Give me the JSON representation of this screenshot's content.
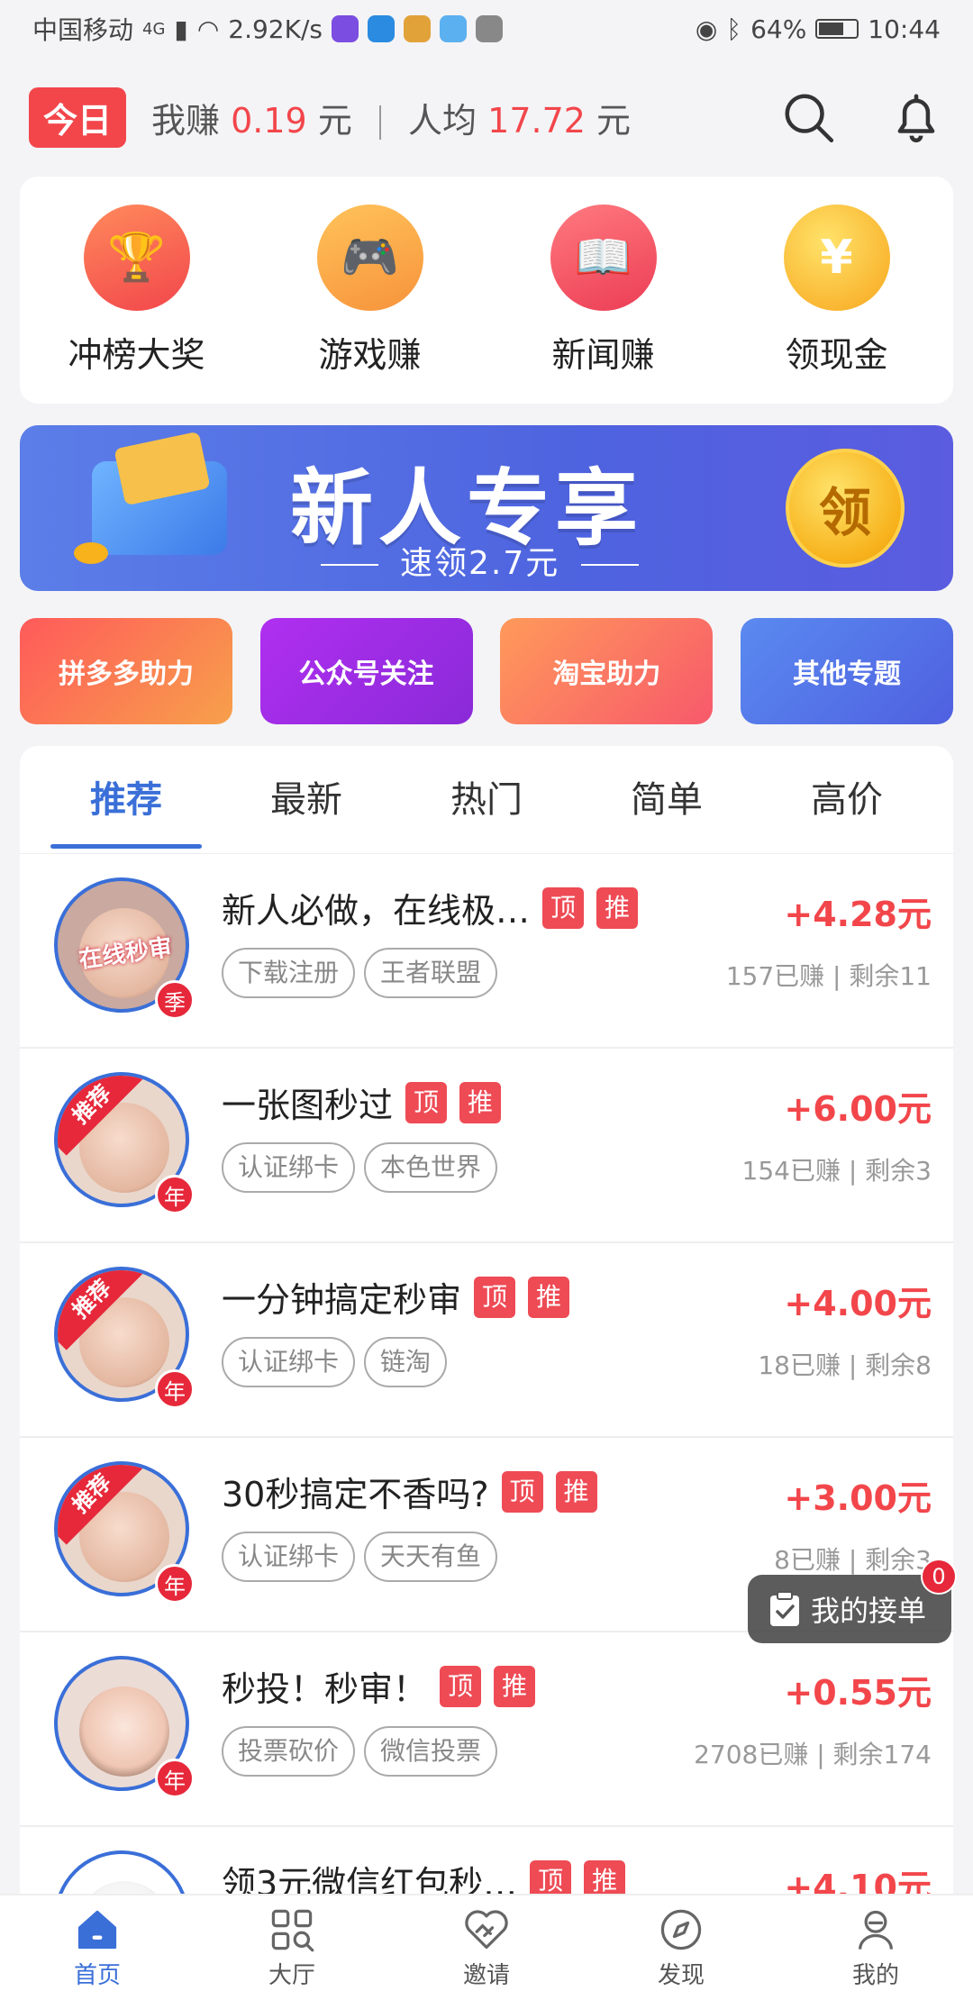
{
  "status_bar": {
    "carrier": "中国移动",
    "network": "4G",
    "speed": "2.92K/s",
    "battery": "64%",
    "time": "10:44"
  },
  "header": {
    "today_badge": "今日",
    "my_earn_label": "我赚",
    "my_earn_value": "0.19",
    "unit": "元",
    "avg_label": "人均",
    "avg_value": "17.72"
  },
  "quick_nav": [
    {
      "label": "冲榜大奖",
      "icon": "trophy-icon",
      "color": "#f2464b"
    },
    {
      "label": "游戏赚",
      "icon": "gamepad-icon",
      "color": "#f7a33b"
    },
    {
      "label": "新闻赚",
      "icon": "news-icon",
      "color": "#f0515d"
    },
    {
      "label": "领现金",
      "icon": "yuan-coin-icon",
      "color": "#f7b21c"
    }
  ],
  "banner": {
    "title": "新人专享",
    "subtitle": "速领2.7元",
    "coin_label": "领"
  },
  "topics": [
    {
      "label": "拼多多助力",
      "color": "#f7624b"
    },
    {
      "label": "公众号关注",
      "color": "#9b2de0"
    },
    {
      "label": "淘宝助力",
      "color": "#f76d6d"
    },
    {
      "label": "其他专题",
      "color": "#4f72e8"
    }
  ],
  "tabs": [
    "推荐",
    "最新",
    "热门",
    "简单",
    "高价"
  ],
  "tasks": [
    {
      "title": "新人必做，在线极…",
      "tag1": "顶",
      "tag2": "推",
      "chips": [
        "下载注册",
        "王者联盟"
      ],
      "reward": "+4.28元",
      "stats": "157已赚 | 剩余11",
      "badge": "季",
      "avatar_text": "在线秒审"
    },
    {
      "title": "一张图秒过",
      "tag1": "顶",
      "tag2": "推",
      "chips": [
        "认证绑卡",
        "本色世界"
      ],
      "reward": "+6.00元",
      "stats": "154已赚 | 剩余3",
      "badge": "年",
      "avatar_text": "推荐"
    },
    {
      "title": "一分钟搞定秒审",
      "tag1": "顶",
      "tag2": "推",
      "chips": [
        "认证绑卡",
        "链淘"
      ],
      "reward": "+4.00元",
      "stats": "18已赚 | 剩余8",
      "badge": "年",
      "avatar_text": "推荐"
    },
    {
      "title": "30秒搞定不香吗?",
      "tag1": "顶",
      "tag2": "推",
      "chips": [
        "认证绑卡",
        "天天有鱼"
      ],
      "reward": "+3.00元",
      "stats": "8已赚 | 剩余3",
      "badge": "年",
      "avatar_text": "推荐"
    },
    {
      "title": "秒投！秒审！",
      "tag1": "顶",
      "tag2": "推",
      "chips": [
        "投票砍价",
        "微信投票"
      ],
      "reward": "+0.55元",
      "stats": "2708已赚 | 剩余174",
      "badge": "年",
      "avatar_text": ""
    },
    {
      "title": "领3元微信红包秒…",
      "tag1": "顶",
      "tag2": "推",
      "chips": [],
      "reward": "+4.10元",
      "stats": "",
      "badge": "",
      "avatar_text": ""
    }
  ],
  "floating": {
    "label": "我的接单",
    "count": "0"
  },
  "bottom_nav": [
    {
      "label": "首页",
      "icon": "home-icon"
    },
    {
      "label": "大厅",
      "icon": "grid-search-icon"
    },
    {
      "label": "邀请",
      "icon": "handshake-icon"
    },
    {
      "label": "发现",
      "icon": "compass-icon"
    },
    {
      "label": "我的",
      "icon": "profile-icon"
    }
  ],
  "colors": {
    "accent": "#3a6fd8",
    "red": "#f2464b"
  }
}
